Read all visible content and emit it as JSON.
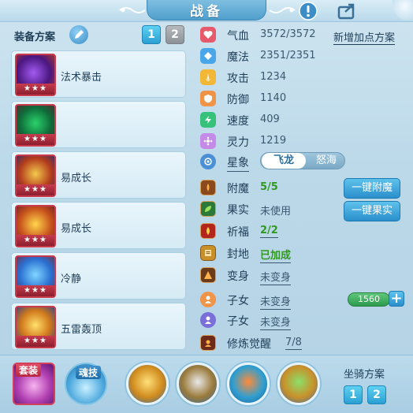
{
  "header": {
    "title": "战备"
  },
  "left": {
    "plan_label": "装备方案",
    "plan_tabs": [
      "1",
      "2"
    ],
    "skills": [
      {
        "name": "法术暴击",
        "stars": "★★★"
      },
      {
        "name": "",
        "stars": "★★★"
      },
      {
        "name": "易成长",
        "stars": "★★★"
      },
      {
        "name": "易成长",
        "stars": "★★★"
      },
      {
        "name": "冷静",
        "stars": "★★★"
      },
      {
        "name": "五雷轰顶",
        "stars": "★★★"
      }
    ]
  },
  "right": {
    "add_plan": "新增加点方案",
    "stats": [
      {
        "label": "气血",
        "value": "3572/3572"
      },
      {
        "label": "魔法",
        "value": "2351/2351"
      },
      {
        "label": "攻击",
        "value": "1234"
      },
      {
        "label": "防御",
        "value": "1140"
      },
      {
        "label": "速度",
        "value": "409"
      },
      {
        "label": "灵力",
        "value": "1219"
      }
    ],
    "star_sign": {
      "label": "星象",
      "options": [
        "飞龙",
        "怒海"
      ]
    },
    "extras": [
      {
        "label": "附魔",
        "value": "5/5"
      },
      {
        "label": "果实",
        "value": "未使用"
      },
      {
        "label": "祈福",
        "value": "2/2"
      },
      {
        "label": "封地",
        "value": "已加成"
      },
      {
        "label": "变身",
        "value": "未变身"
      },
      {
        "label": "子女",
        "value": "未变身"
      },
      {
        "label": "子女",
        "value": "未变身"
      },
      {
        "label": "修炼觉醒",
        "value": "7/8"
      }
    ],
    "one_click_enchant": "一键附魔",
    "one_click_fruit": "一键果实",
    "xp_value": "1560",
    "plus": "+"
  },
  "bottom": {
    "suit": "套装",
    "soul": "魂技",
    "mount_label": "坐骑方案",
    "mount_tabs": [
      "1",
      "2"
    ]
  },
  "colors": {
    "accent": "#2b9fd2",
    "frame_red": "#c73b4d",
    "green_value": "#2f9a1e"
  }
}
